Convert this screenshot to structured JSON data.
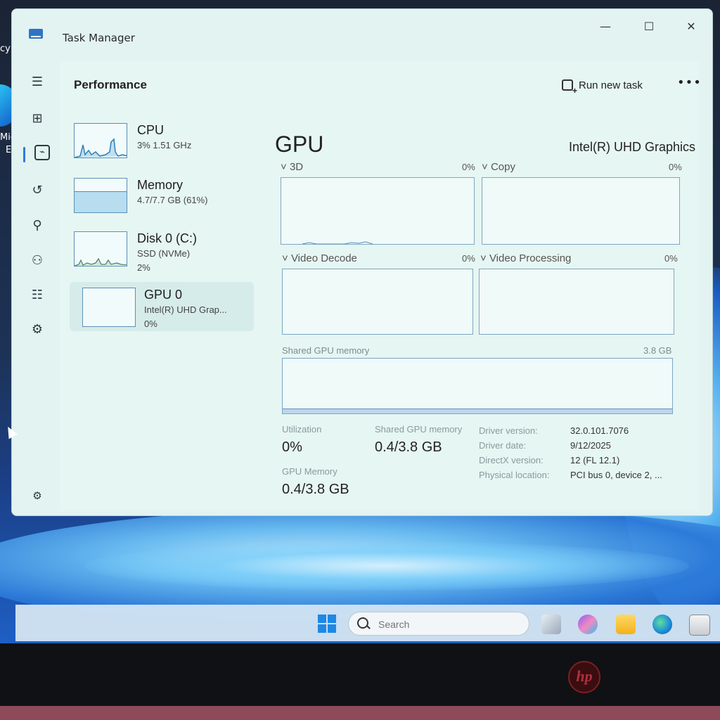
{
  "window": {
    "title": "Task Manager",
    "minimize": "—",
    "maximize": "☐",
    "close": "✕"
  },
  "header": {
    "page_title": "Performance",
    "run_new_task": "Run new task",
    "more": "•••"
  },
  "sidebar": {
    "items": [
      {
        "icon": "hamburger-icon",
        "glyph": "☰"
      },
      {
        "icon": "processes-icon",
        "glyph": "⊞"
      },
      {
        "icon": "performance-icon",
        "glyph": "⌁"
      },
      {
        "icon": "app-history-icon",
        "glyph": "↺"
      },
      {
        "icon": "startup-apps-icon",
        "glyph": "⚲"
      },
      {
        "icon": "users-icon",
        "glyph": "⚇"
      },
      {
        "icon": "details-icon",
        "glyph": "☷"
      },
      {
        "icon": "services-icon",
        "glyph": "⚙"
      },
      {
        "icon": "settings-icon",
        "glyph": "⚙"
      }
    ]
  },
  "devices": [
    {
      "name": "CPU",
      "line2": "3%  1.51 GHz",
      "line3": ""
    },
    {
      "name": "Memory",
      "line2": "4.7/7.7 GB (61%)",
      "line3": ""
    },
    {
      "name": "Disk 0 (C:)",
      "line2": "SSD (NVMe)",
      "line3": "2%"
    },
    {
      "name": "GPU 0",
      "line2": "Intel(R) UHD Grap...",
      "line3": "0%"
    }
  ],
  "memory_usage_fraction": 0.61,
  "gpu": {
    "title": "GPU",
    "model": "Intel(R) UHD Graphics",
    "engines": [
      {
        "label": "3D",
        "pct": "0%"
      },
      {
        "label": "Copy",
        "pct": "0%"
      },
      {
        "label": "Video Decode",
        "pct": "0%"
      },
      {
        "label": "Video Processing",
        "pct": "0%"
      }
    ],
    "shared_mem_label": "Shared GPU memory",
    "shared_mem_max": "3.8 GB",
    "stats": {
      "utilization_label": "Utilization",
      "utilization": "0%",
      "shared_label": "Shared GPU memory",
      "shared": "0.4/3.8 GB",
      "gpumem_label": "GPU Memory",
      "gpumem": "0.4/3.8 GB"
    },
    "details": [
      {
        "k": "Driver version:",
        "v": "32.0.101.7076"
      },
      {
        "k": "Driver date:",
        "v": "9/12/2025"
      },
      {
        "k": "DirectX version:",
        "v": "12 (FL 12.1)"
      },
      {
        "k": "Physical location:",
        "v": "PCI bus 0, device 2, ..."
      }
    ]
  },
  "desktop": {
    "edge_label_1": "Micr",
    "edge_label_2": "Ec",
    "edge_label_top": "cy"
  },
  "taskbar": {
    "search_placeholder": "Search"
  },
  "logo": {
    "brand": "hp"
  },
  "colors": {
    "accent": "#2b7de0",
    "window_bg": "#e2f3f1",
    "graph_border": "#7ea7c4"
  }
}
